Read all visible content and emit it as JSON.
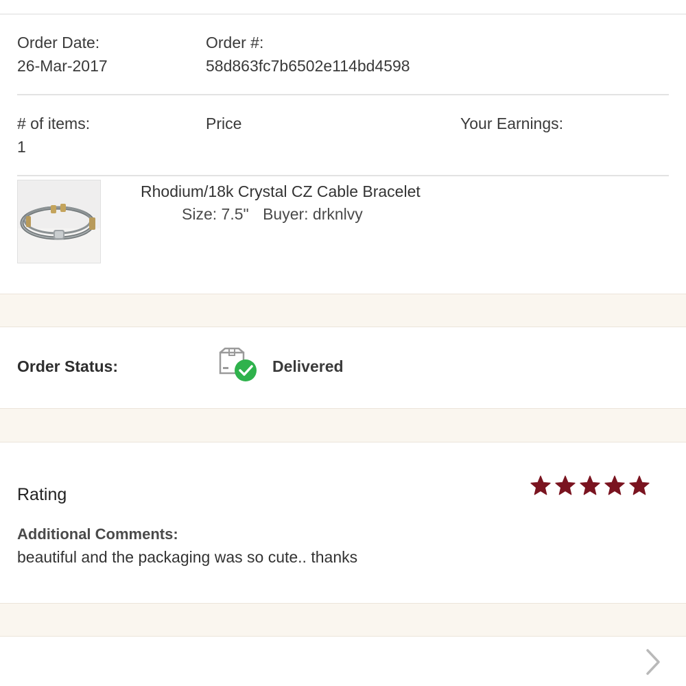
{
  "order": {
    "date_label": "Order Date:",
    "date_value": "26-Mar-2017",
    "number_label": "Order #:",
    "number_value": "58d863fc7b6502e114bd4598"
  },
  "summary": {
    "items_label": "# of items:",
    "items_value": "1",
    "price_label": "Price",
    "earnings_label": "Your Earnings:"
  },
  "product": {
    "title": "Rhodium/18k Crystal CZ Cable Bracelet",
    "size": "Size: 7.5\"",
    "buyer": "Buyer: drknlvy",
    "image_icon": "bracelet-photo"
  },
  "status": {
    "label": "Order Status:",
    "value": "Delivered",
    "icon": "package-delivered-icon"
  },
  "review": {
    "rating_label": "Rating",
    "rating_value": 5,
    "rating_max": 5,
    "comments_label": "Additional Comments:",
    "comments_text": "beautiful and the packaging was so cute.. thanks"
  },
  "colors": {
    "star": "#7a1420",
    "band": "#faf6ef",
    "check_green": "#2fb24c",
    "text": "#333333"
  },
  "nav": {
    "next_icon": "chevron-right-icon"
  }
}
